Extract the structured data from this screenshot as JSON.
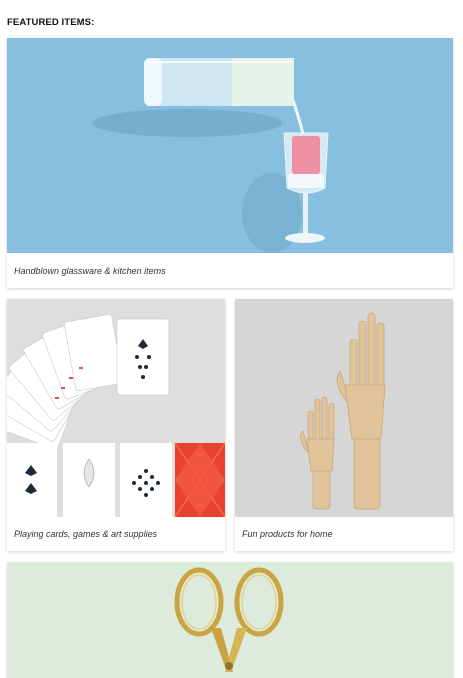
{
  "section": {
    "title": "FEATURED ITEMS:"
  },
  "cards": [
    {
      "caption": "Handblown glassware & kitchen items",
      "image": "glass-pouring-photo"
    },
    {
      "caption": "Playing cards, games & art supplies",
      "image": "playing-cards-photo"
    },
    {
      "caption": "Fun products for home",
      "image": "wooden-hands-photo"
    },
    {
      "caption": "",
      "image": "gold-scissors-photo"
    }
  ],
  "colors": {
    "glass_bg": "#86bfdf",
    "cards_bg": "#dedede",
    "hands_bg": "#d6d6d6",
    "scissors_bg": "#dcebdc",
    "red_card": "#e8412e",
    "gold": "#c9a441"
  }
}
